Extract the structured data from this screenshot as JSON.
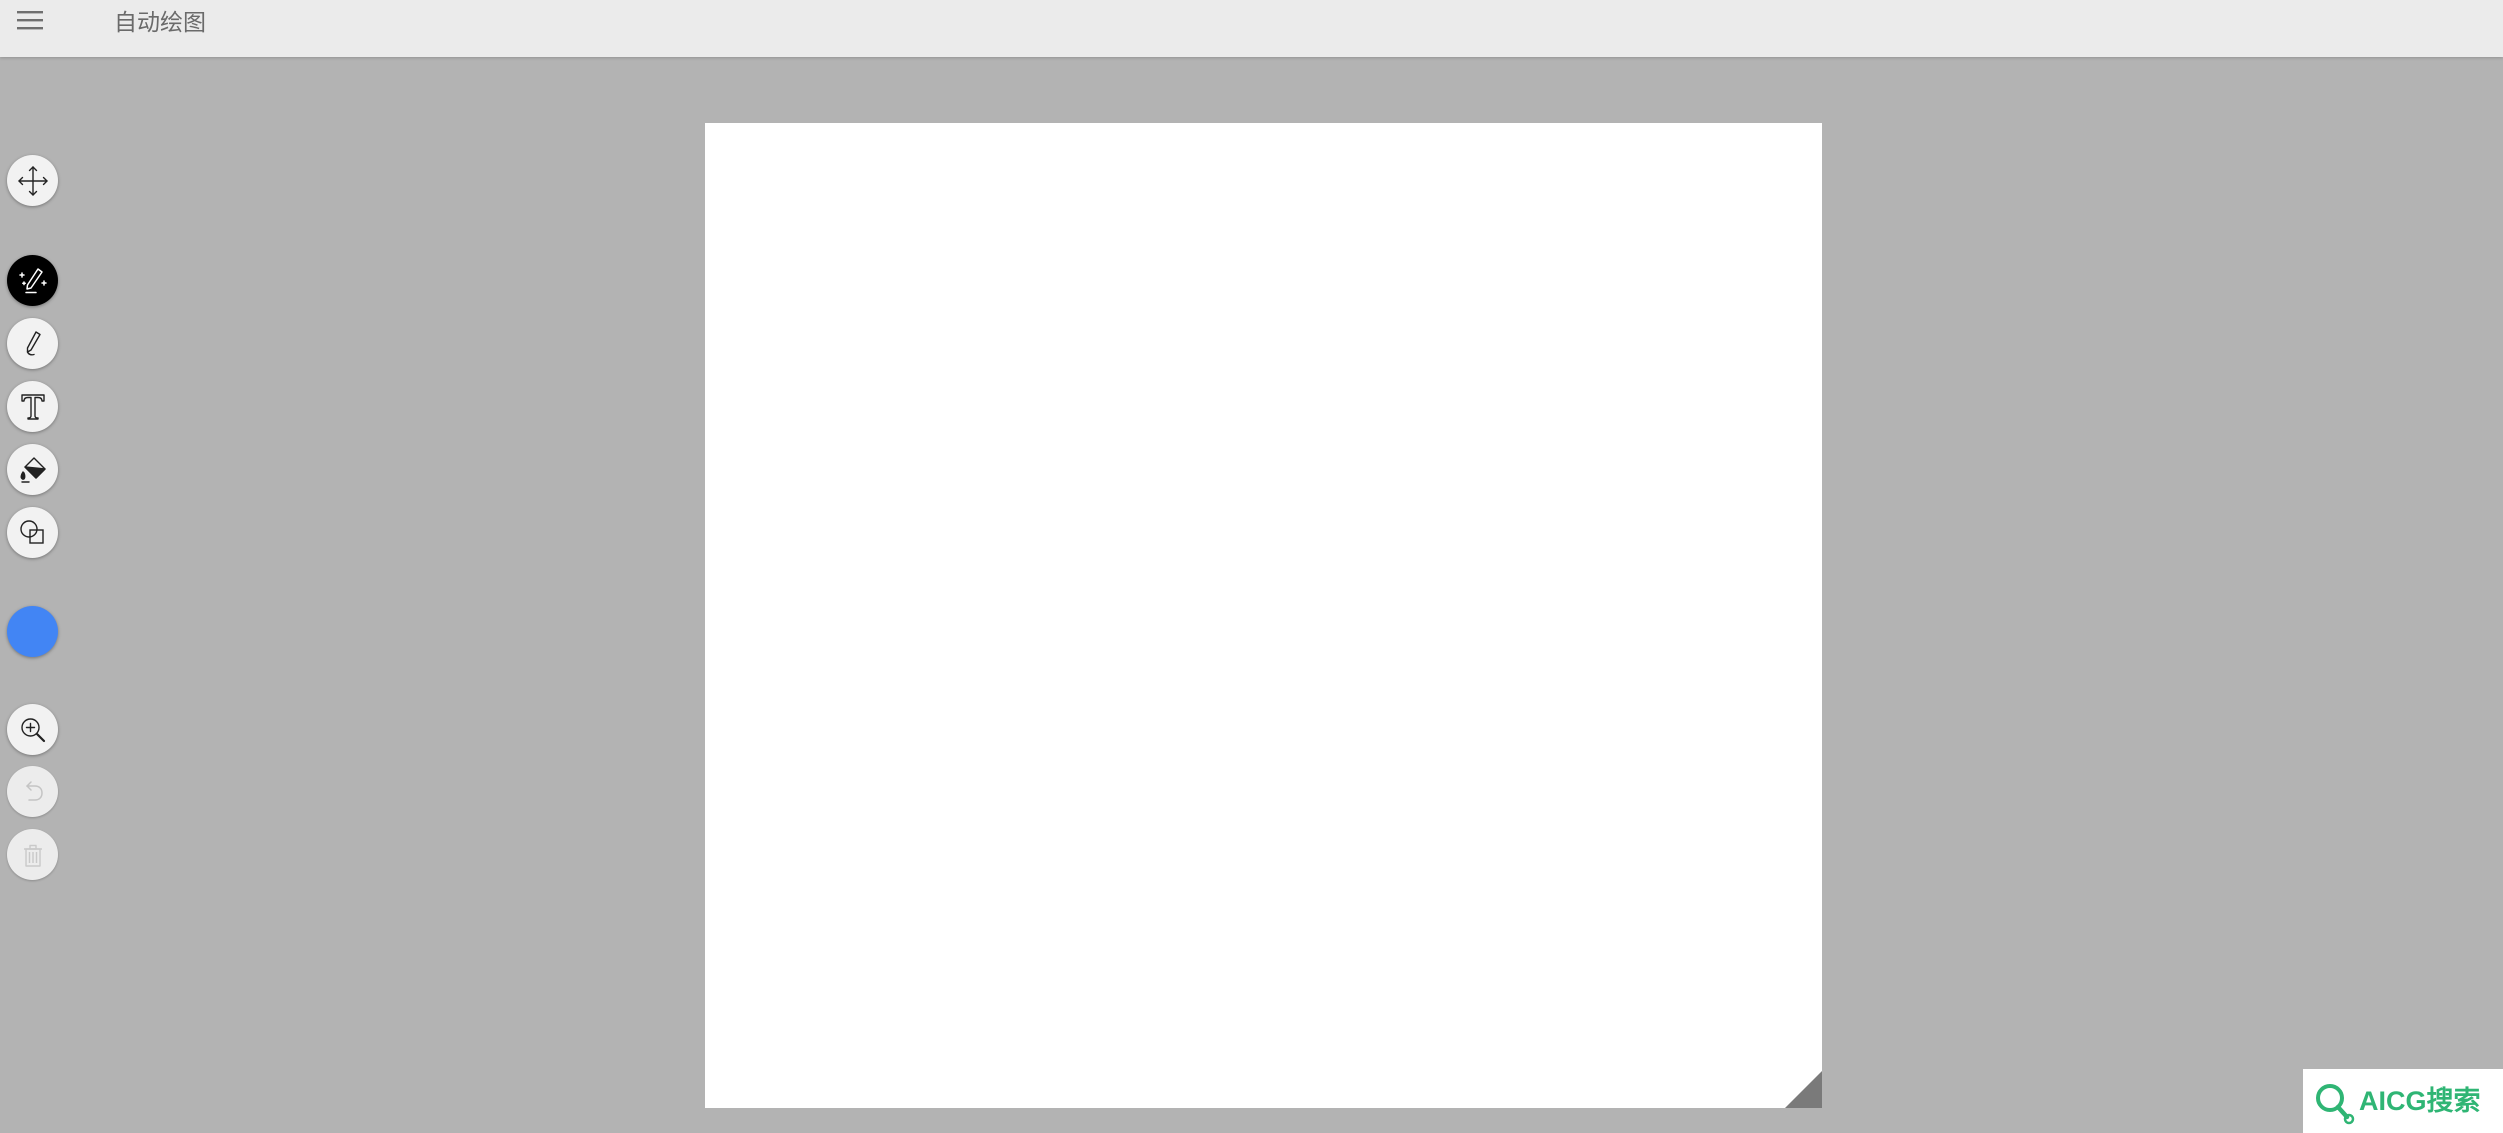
{
  "header": {
    "menu_icon": "hamburger-menu-icon",
    "title": "自动绘图"
  },
  "toolbar": {
    "tools": [
      {
        "id": "move",
        "icon": "move-arrows-icon",
        "state": "normal"
      },
      {
        "id": "auto-draw",
        "icon": "magic-pencil-icon",
        "state": "active"
      },
      {
        "id": "draw",
        "icon": "pencil-icon",
        "state": "normal"
      },
      {
        "id": "text",
        "icon": "text-t-icon",
        "state": "normal"
      },
      {
        "id": "fill",
        "icon": "paint-bucket-icon",
        "state": "normal"
      },
      {
        "id": "shapes",
        "icon": "shapes-icon",
        "state": "normal"
      },
      {
        "id": "color",
        "icon": "color-swatch",
        "state": "normal"
      },
      {
        "id": "zoom",
        "icon": "zoom-in-icon",
        "state": "normal"
      },
      {
        "id": "undo",
        "icon": "undo-icon",
        "state": "disabled"
      },
      {
        "id": "delete",
        "icon": "trash-icon",
        "state": "disabled"
      }
    ]
  },
  "colors": {
    "topbar": "#ebebeb",
    "workspace": "#b3b3b3",
    "canvas": "#ffffff",
    "active_tool": "#000000",
    "selected_color": "#4285f4",
    "watermark_green": "#2fb574",
    "resize_handle": "#7a7a7a"
  },
  "watermark": {
    "icon": "magnifier-logo-icon",
    "text": "AICG搜索"
  }
}
